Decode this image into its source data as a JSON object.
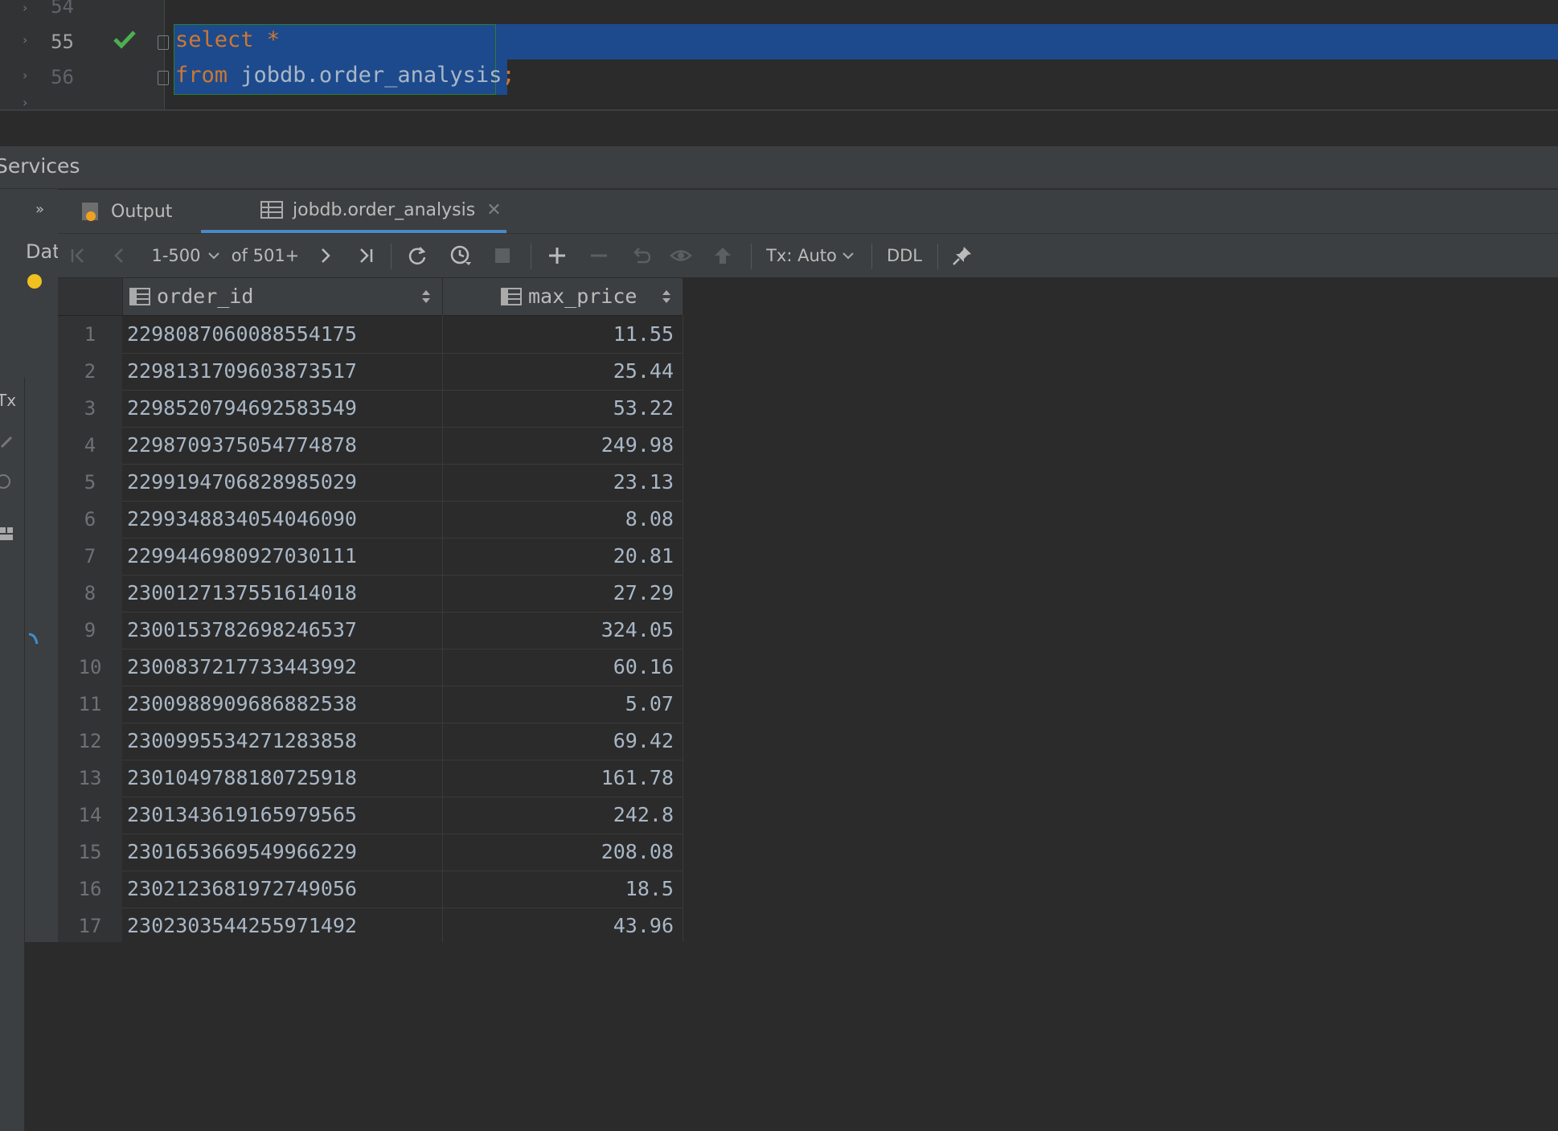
{
  "editor": {
    "lines": [
      {
        "number": "54",
        "text": ""
      },
      {
        "number": "55",
        "keyword": "select",
        "rest": " *"
      },
      {
        "number": "56",
        "keyword": "from",
        "rest": " jobdb.order_analysis",
        "end": ";"
      }
    ],
    "status_icon": "check-icon"
  },
  "services": {
    "title": "Services",
    "left_labels": {
      "tx": "Tx",
      "db": "Dat"
    }
  },
  "tabs": {
    "output_label": "Output",
    "results_label": "jobdb.order_analysis"
  },
  "toolbar": {
    "page_range": "1-500",
    "page_total": "of 501+",
    "tx_label": "Tx: Auto",
    "ddl_label": "DDL"
  },
  "table": {
    "columns": [
      "order_id",
      "max_price"
    ],
    "rows": [
      {
        "n": "1",
        "order_id": "2298087060088554175",
        "max_price": "11.55"
      },
      {
        "n": "2",
        "order_id": "2298131709603873517",
        "max_price": "25.44"
      },
      {
        "n": "3",
        "order_id": "2298520794692583549",
        "max_price": "53.22"
      },
      {
        "n": "4",
        "order_id": "2298709375054774878",
        "max_price": "249.98"
      },
      {
        "n": "5",
        "order_id": "2299194706828985029",
        "max_price": "23.13"
      },
      {
        "n": "6",
        "order_id": "2299348834054046090",
        "max_price": "8.08"
      },
      {
        "n": "7",
        "order_id": "2299446980927030111",
        "max_price": "20.81"
      },
      {
        "n": "8",
        "order_id": "2300127137551614018",
        "max_price": "27.29"
      },
      {
        "n": "9",
        "order_id": "2300153782698246537",
        "max_price": "324.05"
      },
      {
        "n": "10",
        "order_id": "2300837217733443992",
        "max_price": "60.16"
      },
      {
        "n": "11",
        "order_id": "2300988909686882538",
        "max_price": "5.07"
      },
      {
        "n": "12",
        "order_id": "2300995534271283858",
        "max_price": "69.42"
      },
      {
        "n": "13",
        "order_id": "2301049788180725918",
        "max_price": "161.78"
      },
      {
        "n": "14",
        "order_id": "2301343619165979565",
        "max_price": "242.8"
      },
      {
        "n": "15",
        "order_id": "2301653669549966229",
        "max_price": "208.08"
      },
      {
        "n": "16",
        "order_id": "2302123681972749056",
        "max_price": "18.5"
      },
      {
        "n": "17",
        "order_id": "2302303544255971492",
        "max_price": "43.96"
      }
    ]
  },
  "colors": {
    "selection": "#1d4a8c",
    "keyword": "#cc7832",
    "check": "#4caf50",
    "tab_underline": "#4a88c7"
  }
}
